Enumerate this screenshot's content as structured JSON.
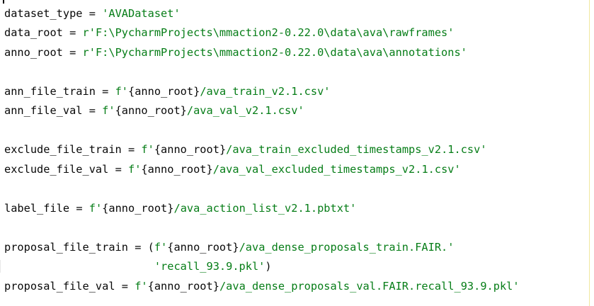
{
  "editor": {
    "lines": [
      {
        "var": "dataset_type",
        "op": " = ",
        "str": "'AVADataset'"
      },
      {
        "var": "data_root",
        "op": " = ",
        "str": "r'F:\\PycharmProjects\\mmaction2-0.22.0\\data\\ava\\rawframes'"
      },
      {
        "var": "anno_root",
        "op": " = ",
        "str": "r'F:\\PycharmProjects\\mmaction2-0.22.0\\data\\ava\\annotations'"
      },
      {
        "var": "ann_file_train",
        "op": " = ",
        "fpre": "f'",
        "brace": "{anno_root}",
        "fpost": "/ava_train_v2.1.csv'"
      },
      {
        "var": "ann_file_val",
        "op": " = ",
        "fpre": "f'",
        "brace": "{anno_root}",
        "fpost": "/ava_val_v2.1.csv'"
      },
      {
        "var": "exclude_file_train",
        "op": " = ",
        "fpre": "f'",
        "brace": "{anno_root}",
        "fpost": "/ava_train_excluded_timestamps_v2.1.csv'"
      },
      {
        "var": "exclude_file_val",
        "op": " = ",
        "fpre": "f'",
        "brace": "{anno_root}",
        "fpost": "/ava_val_excluded_timestamps_v2.1.csv'"
      },
      {
        "var": "label_file",
        "op": " = ",
        "fpre": "f'",
        "brace": "{anno_root}",
        "fpost": "/ava_action_list_v2.1.pbtxt'"
      },
      {
        "var": "proposal_file_train",
        "op": " = (",
        "fpre": "f'",
        "brace": "{anno_root}",
        "fpost": "/ava_dense_proposals_train.FAIR.'"
      },
      {
        "cont_indent": "                       ",
        "str": "'recall_93.9.pkl'",
        "close": ")"
      },
      {
        "var": "proposal_file_val",
        "op": " = ",
        "fpre": "f'",
        "brace": "{anno_root}",
        "fpost": "/ava_dense_proposals_val.FAIR.recall_93.9.pkl'"
      }
    ]
  }
}
